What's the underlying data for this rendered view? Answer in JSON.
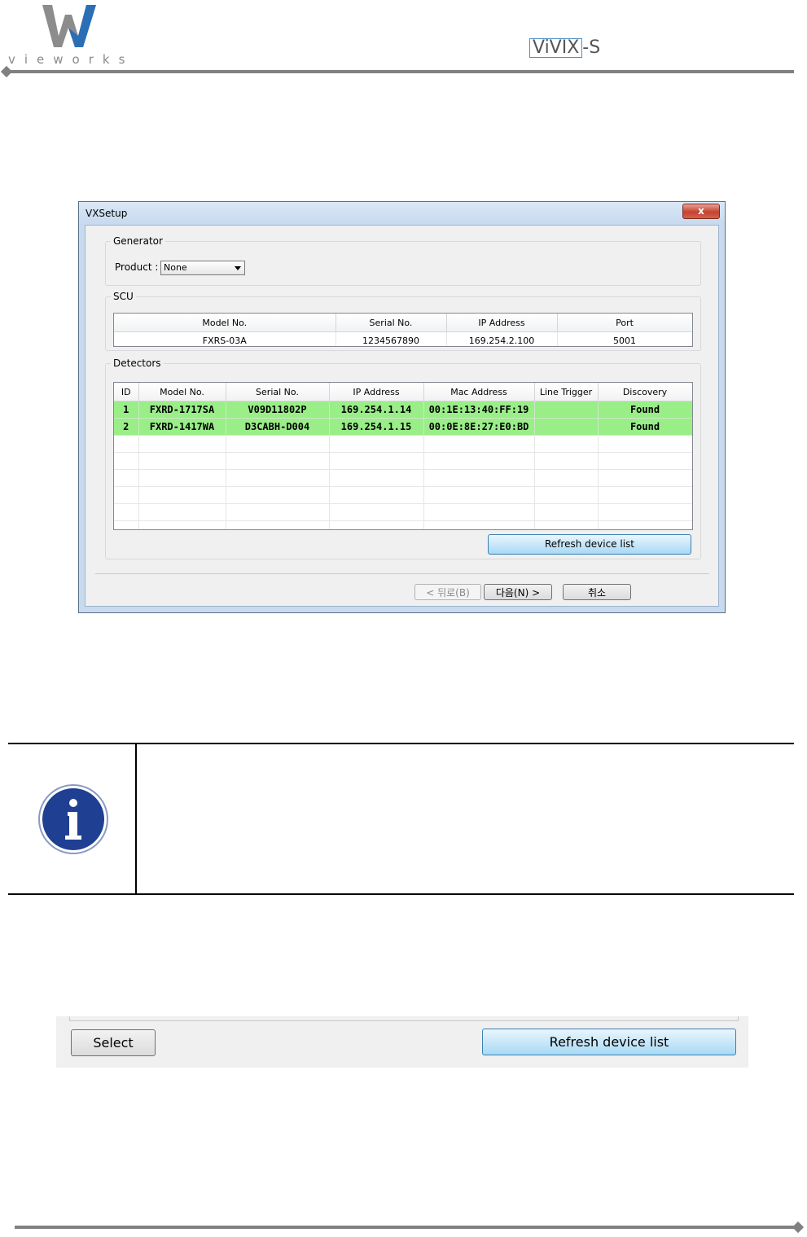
{
  "header": {
    "company_logo_text": "vieworks",
    "product_logo_prefix": "ViVIX",
    "product_logo_suffix": "-S"
  },
  "window": {
    "title": "VXSetup",
    "close_glyph": "x",
    "generator": {
      "legend": "Generator",
      "product_label": "Product :",
      "product_value": "None"
    },
    "scu": {
      "legend": "SCU",
      "columns": [
        "Model No.",
        "Serial No.",
        "IP Address",
        "Port"
      ],
      "row": [
        "FXRS-03A",
        "1234567890",
        "169.254.2.100",
        "5001"
      ]
    },
    "detectors": {
      "legend": "Detectors",
      "columns": [
        "ID",
        "Model No.",
        "Serial No.",
        "IP Address",
        "Mac Address",
        "Line Trigger",
        "Discovery"
      ],
      "rows": [
        [
          "1",
          "FXRD-1717SA",
          "V09D11802P",
          "169.254.1.14",
          "00:1E:13:40:FF:19",
          "",
          "Found"
        ],
        [
          "2",
          "FXRD-1417WA",
          "D3CABH-D004",
          "169.254.1.15",
          "00:0E:8E:27:E0:BD",
          "",
          "Found"
        ]
      ],
      "refresh_label": "Refresh device list"
    },
    "buttons": {
      "back": "< 뒤로(B)",
      "next": "다음(N) >",
      "cancel": "취소"
    }
  },
  "strip": {
    "select_label": "Select",
    "refresh_label": "Refresh device list"
  },
  "colors": {
    "found_row": "#99ee88",
    "button_blue": "#a7d9f5",
    "info_icon": "#1f3f93"
  }
}
